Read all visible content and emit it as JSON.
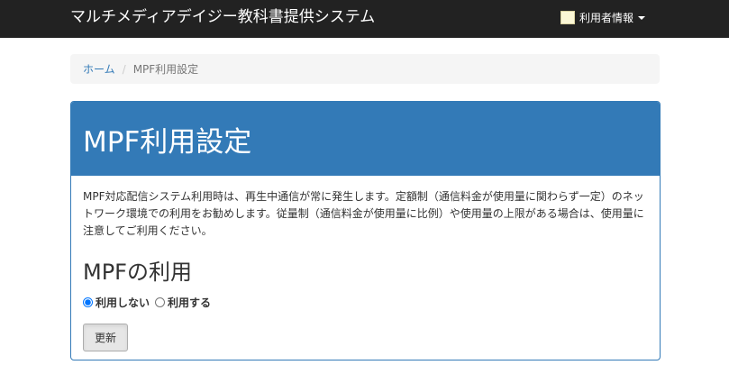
{
  "navbar": {
    "brand": "マルチメディアデイジー教科書提供システム",
    "user_menu_label": "利用者情報"
  },
  "breadcrumb": {
    "home": "ホーム",
    "current": "MPF利用設定"
  },
  "panel": {
    "title": "MPF利用設定",
    "description": "MPF対応配信システム利用時は、再生中通信が常に発生します。定額制（通信料金が使用量に関わらず一定）のネットワーク環境での利用をお勧めします。従量制（通信料金が使用量に比例）や使用量の上限がある場合は、使用量に注意してご利用ください。",
    "section_title": "MPFの利用",
    "radio_options": [
      {
        "label": "利用しない",
        "checked": true
      },
      {
        "label": "利用する",
        "checked": false
      }
    ],
    "update_button": "更新"
  },
  "colors": {
    "navbar_bg": "#222222",
    "primary": "#337ab7",
    "breadcrumb_bg": "#f5f5f5"
  },
  "icons": {
    "user": "user-icon",
    "caret": "caret-down-icon"
  }
}
